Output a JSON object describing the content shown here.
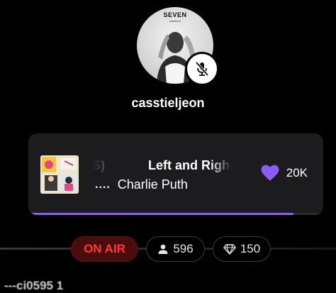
{
  "profile": {
    "avatar_cover_title": "SEVEN",
    "avatar_cover_sub": "weekend",
    "username": "casstieljeon",
    "mic_status_icon": "mic-muted-icon"
  },
  "now_playing": {
    "previous_title_fragment": "S)",
    "title": "Left and Right",
    "artist_prefix": "....",
    "artist": "Charlie Puth",
    "likes": "20K",
    "like_icon": "heart-icon",
    "like_color": "#8b5cf6",
    "progress": 0.9
  },
  "status_bar": {
    "on_air_label": "ON AIR",
    "on_air_color": "#ff3b30",
    "viewers_count": "596",
    "viewers_icon": "person-icon",
    "gems_count": "150",
    "gems_icon": "diamond-icon"
  },
  "chat_preview": {
    "text": "---ci0595 1"
  }
}
